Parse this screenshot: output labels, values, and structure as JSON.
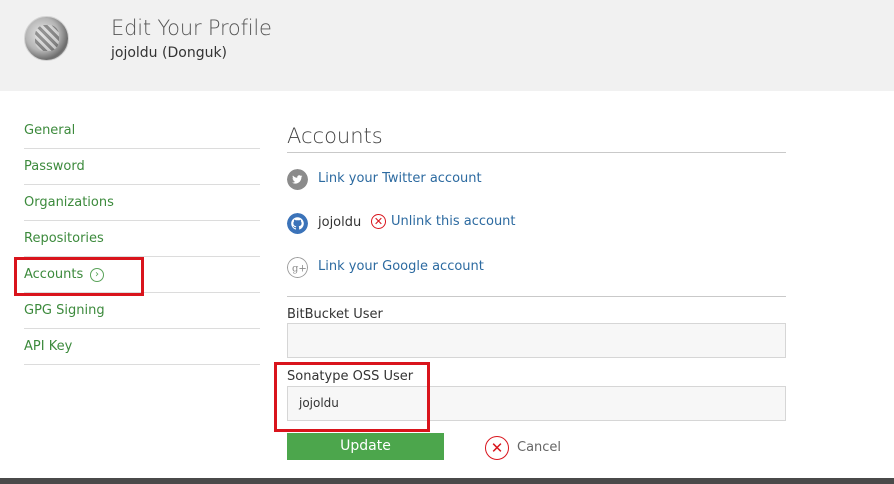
{
  "header": {
    "title": "Edit Your Profile",
    "user": "jojoldu (Donguk)"
  },
  "sidebar": {
    "items": [
      {
        "label": "General"
      },
      {
        "label": "Password"
      },
      {
        "label": "Organizations"
      },
      {
        "label": "Repositories"
      },
      {
        "label": "Accounts",
        "active": true
      },
      {
        "label": "GPG Signing"
      },
      {
        "label": "API Key"
      }
    ]
  },
  "main": {
    "section_title": "Accounts",
    "twitter": {
      "icon": "twitter-icon",
      "link": "Link your Twitter account"
    },
    "github": {
      "icon": "github-icon",
      "username": "jojoldu",
      "unlink": "Unlink this account"
    },
    "google": {
      "icon": "google-plus-icon",
      "link": "Link your Google account"
    },
    "bitbucket": {
      "label": "BitBucket User",
      "value": ""
    },
    "sonatype": {
      "label": "Sonatype OSS User",
      "value": "jojoldu"
    },
    "update_label": "Update",
    "cancel_label": "Cancel"
  },
  "colors": {
    "link_green": "#3c8a3c",
    "button_green": "#4ca64c",
    "highlight_red": "#d9141c",
    "link_blue": "#2c6aa0"
  }
}
